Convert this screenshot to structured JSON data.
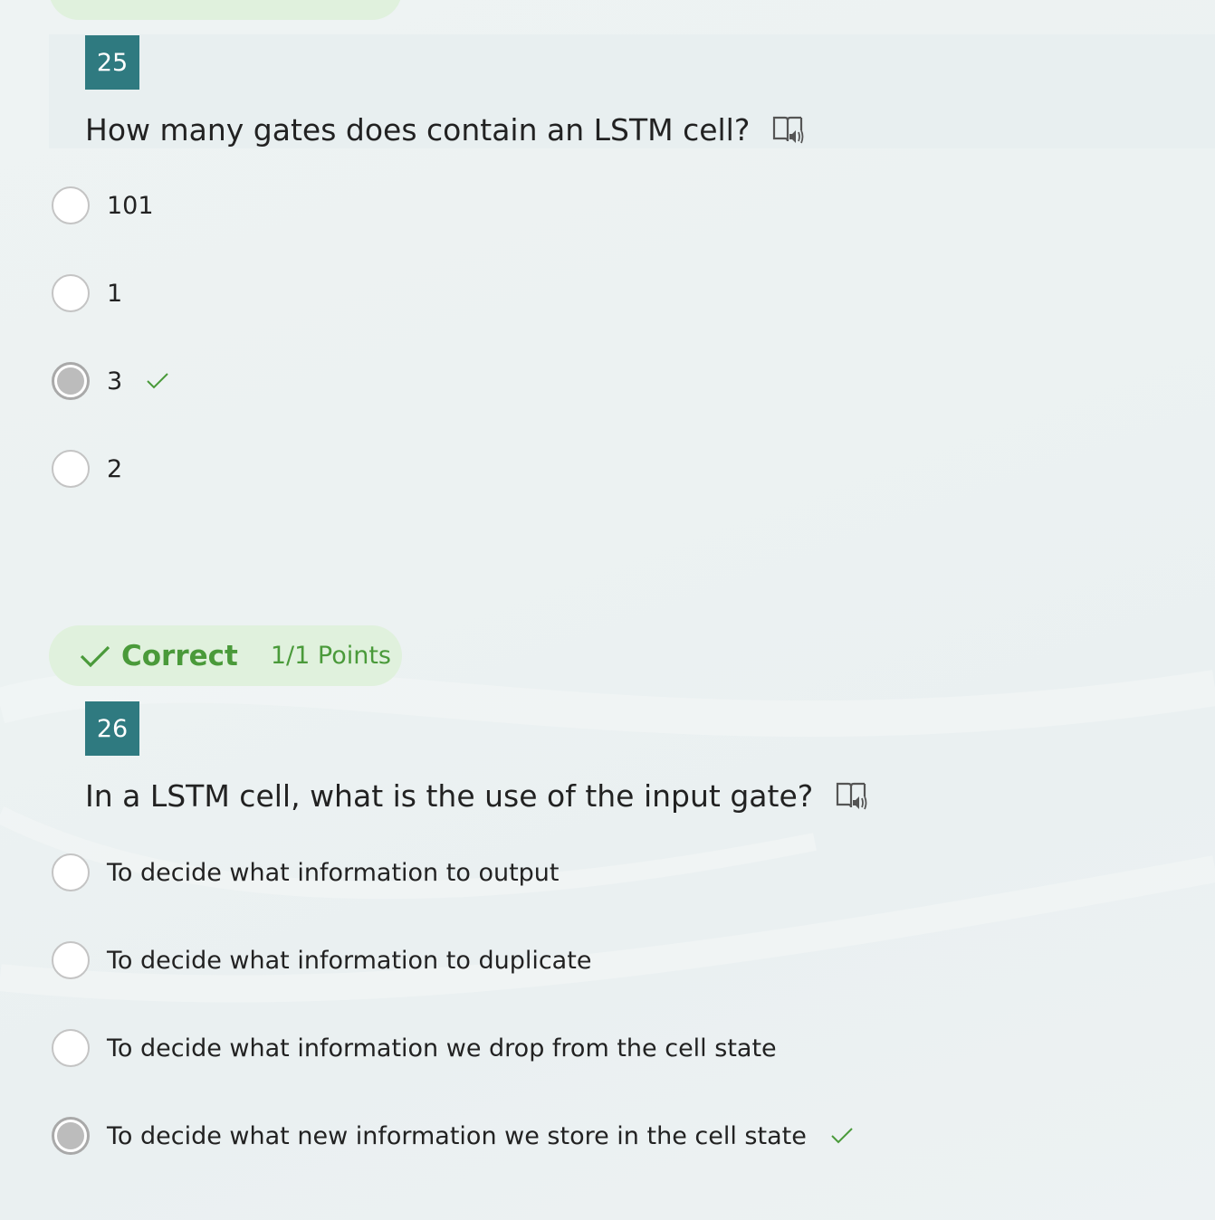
{
  "questions": [
    {
      "number": "25",
      "title": "How many gates does contain an LSTM cell?",
      "options": [
        {
          "label": "101",
          "selected": false,
          "correct": false
        },
        {
          "label": "1",
          "selected": false,
          "correct": false
        },
        {
          "label": "3",
          "selected": true,
          "correct": true
        },
        {
          "label": "2",
          "selected": false,
          "correct": false
        }
      ]
    },
    {
      "result": {
        "label": "Correct",
        "points": "1/1 Points"
      },
      "number": "26",
      "title": "In a LSTM cell, what is the use of the input gate?",
      "options": [
        {
          "label": "To decide what information to output",
          "selected": false,
          "correct": false
        },
        {
          "label": "To decide what information to duplicate",
          "selected": false,
          "correct": false
        },
        {
          "label": "To decide what information we drop from the cell state",
          "selected": false,
          "correct": false
        },
        {
          "label": "To decide what new information we store in the cell state",
          "selected": true,
          "correct": true
        }
      ]
    }
  ],
  "colors": {
    "question_number_bg": "#2f7a80",
    "correct_green": "#4a9a3a",
    "result_pill_bg": "#e0f1dd"
  },
  "icons": {
    "immersive_reader": "immersive-reader-icon",
    "correct_check": "checkmark-icon"
  }
}
